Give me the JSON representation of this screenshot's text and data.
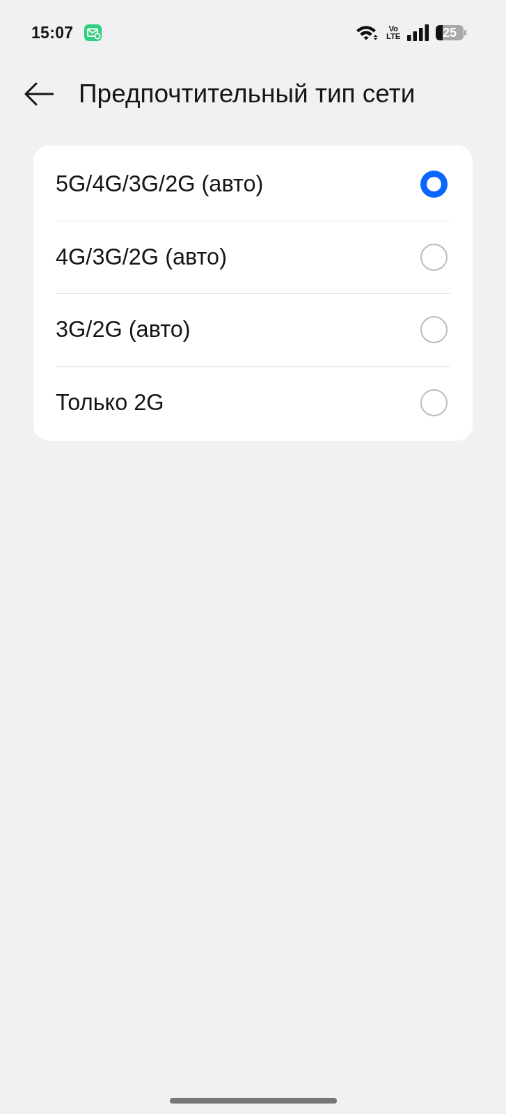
{
  "status_bar": {
    "time": "15:07",
    "volte_top": "Vo",
    "volte_bottom": "LTE",
    "battery": "25"
  },
  "header": {
    "title": "Предпочтительный тип сети"
  },
  "options": [
    {
      "label": "5G/4G/3G/2G (авто)",
      "selected": true
    },
    {
      "label": "4G/3G/2G (авто)",
      "selected": false
    },
    {
      "label": "3G/2G (авто)",
      "selected": false
    },
    {
      "label": "Только 2G",
      "selected": false
    }
  ]
}
